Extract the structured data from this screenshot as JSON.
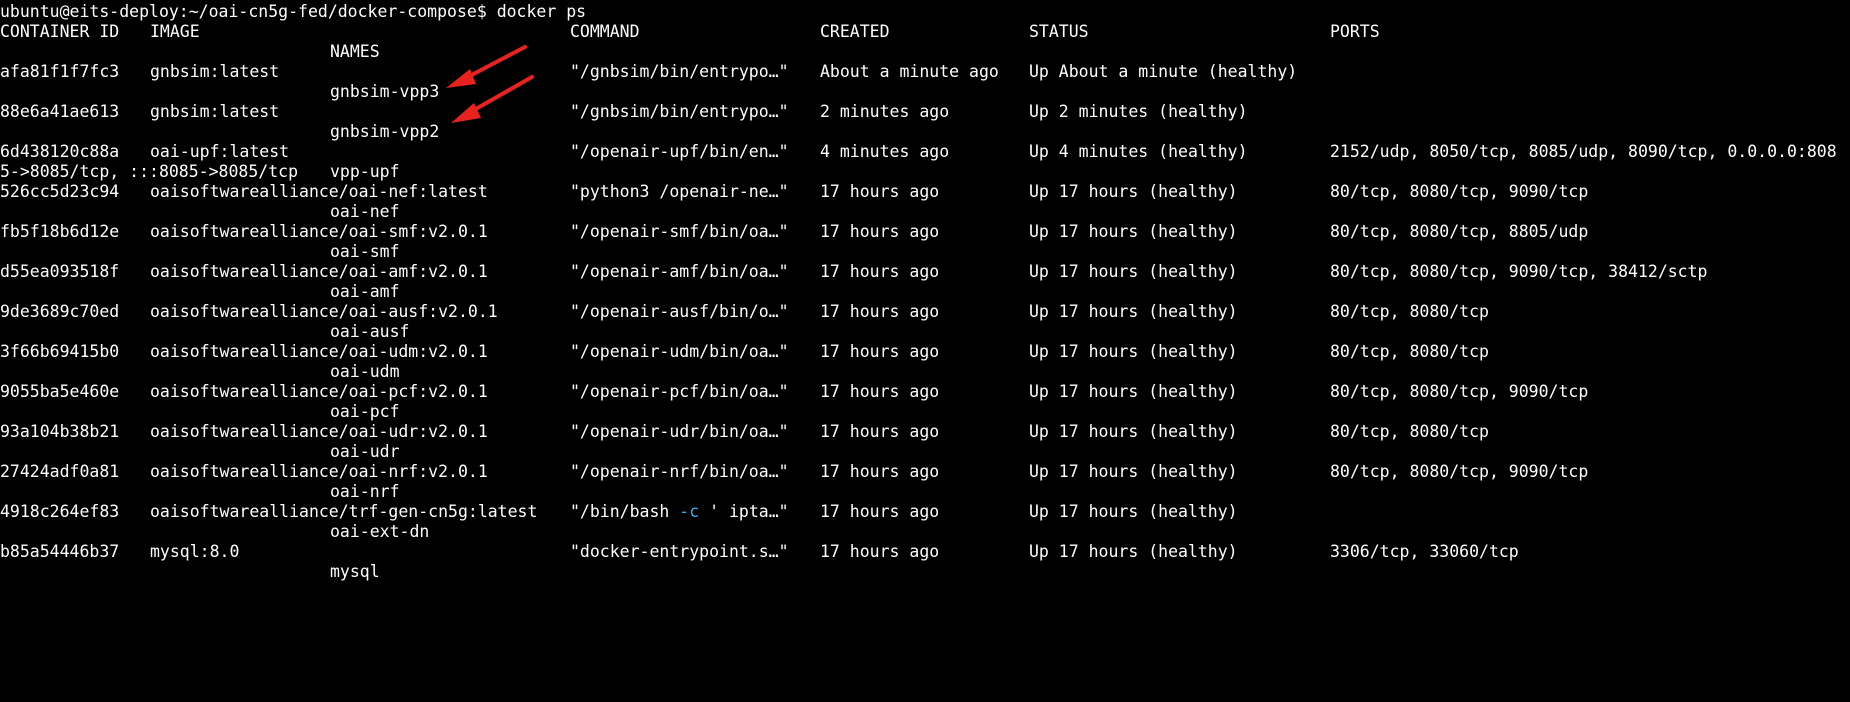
{
  "prompt": "ubuntu@eits-deploy:~/oai-cn5g-fed/docker-compose$ docker ps",
  "header": {
    "container_id": "CONTAINER ID",
    "image": "IMAGE",
    "command": "COMMAND",
    "created": "CREATED",
    "status": "STATUS",
    "ports": "PORTS",
    "names": "NAMES"
  },
  "rows": [
    {
      "id": "afa81f1f7fc3",
      "image": "gnbsim:latest",
      "command": "\"/gnbsim/bin/entrypo…\"",
      "created": "About a minute ago",
      "status": "Up About a minute (healthy)",
      "ports": "",
      "name": "gnbsim-vpp3"
    },
    {
      "id": "88e6a41ae613",
      "image": "gnbsim:latest",
      "command": "\"/gnbsim/bin/entrypo…\"",
      "created": "2 minutes ago",
      "status": "Up 2 minutes (healthy)",
      "ports": "",
      "name": "gnbsim-vpp2"
    },
    {
      "id": "6d438120c88a",
      "image": "oai-upf:latest",
      "command": "\"/openair-upf/bin/en…\"",
      "created": "4 minutes ago",
      "status": "Up 4 minutes (healthy)",
      "ports": "2152/udp, 8050/tcp, 8085/udp, 8090/tcp, 0.0.0.0:808",
      "ports_wrap": "5->8085/tcp, :::8085->8085/tcp",
      "name": "vpp-upf"
    },
    {
      "id": "526cc5d23c94",
      "image": "oaisoftwarealliance/oai-nef:latest",
      "command": "\"python3 /openair-ne…\"",
      "created": "17 hours ago",
      "status": "Up 17 hours (healthy)",
      "ports": "80/tcp, 8080/tcp, 9090/tcp",
      "name": "oai-nef"
    },
    {
      "id": "fb5f18b6d12e",
      "image": "oaisoftwarealliance/oai-smf:v2.0.1",
      "command": "\"/openair-smf/bin/oa…\"",
      "created": "17 hours ago",
      "status": "Up 17 hours (healthy)",
      "ports": "80/tcp, 8080/tcp, 8805/udp",
      "name": "oai-smf"
    },
    {
      "id": "d55ea093518f",
      "image": "oaisoftwarealliance/oai-amf:v2.0.1",
      "command": "\"/openair-amf/bin/oa…\"",
      "created": "17 hours ago",
      "status": "Up 17 hours (healthy)",
      "ports": "80/tcp, 8080/tcp, 9090/tcp, 38412/sctp",
      "name": "oai-amf"
    },
    {
      "id": "9de3689c70ed",
      "image": "oaisoftwarealliance/oai-ausf:v2.0.1",
      "command": "\"/openair-ausf/bin/o…\"",
      "created": "17 hours ago",
      "status": "Up 17 hours (healthy)",
      "ports": "80/tcp, 8080/tcp",
      "name": "oai-ausf"
    },
    {
      "id": "3f66b69415b0",
      "image": "oaisoftwarealliance/oai-udm:v2.0.1",
      "command": "\"/openair-udm/bin/oa…\"",
      "created": "17 hours ago",
      "status": "Up 17 hours (healthy)",
      "ports": "80/tcp, 8080/tcp",
      "name": "oai-udm"
    },
    {
      "id": "9055ba5e460e",
      "image": "oaisoftwarealliance/oai-pcf:v2.0.1",
      "command": "\"/openair-pcf/bin/oa…\"",
      "created": "17 hours ago",
      "status": "Up 17 hours (healthy)",
      "ports": "80/tcp, 8080/tcp, 9090/tcp",
      "name": "oai-pcf"
    },
    {
      "id": "93a104b38b21",
      "image": "oaisoftwarealliance/oai-udr:v2.0.1",
      "command": "\"/openair-udr/bin/oa…\"",
      "created": "17 hours ago",
      "status": "Up 17 hours (healthy)",
      "ports": "80/tcp, 8080/tcp",
      "name": "oai-udr"
    },
    {
      "id": "27424adf0a81",
      "image": "oaisoftwarealliance/oai-nrf:v2.0.1",
      "command": "\"/openair-nrf/bin/oa…\"",
      "created": "17 hours ago",
      "status": "Up 17 hours (healthy)",
      "ports": "80/tcp, 8080/tcp, 9090/tcp",
      "name": "oai-nrf"
    },
    {
      "id": "4918c264ef83",
      "image": "oaisoftwarealliance/trf-gen-cn5g:latest",
      "command_pre": "\"/bin/bash ",
      "command_flag": "-c",
      "command_post": " ' ipta…\"",
      "created": "17 hours ago",
      "status": "Up 17 hours (healthy)",
      "ports": "",
      "name": "oai-ext-dn"
    },
    {
      "id": "b85a54446b37",
      "image": "mysql:8.0",
      "command": "\"docker-entrypoint.s…\"",
      "created": "17 hours ago",
      "status": "Up 17 hours (healthy)",
      "ports": "3306/tcp, 33060/tcp",
      "name": "mysql"
    }
  ],
  "colors": {
    "background": "#000000",
    "text": "#ffffff",
    "flag": "#3fa9f5",
    "annotation_arrow": "#e8231f"
  }
}
